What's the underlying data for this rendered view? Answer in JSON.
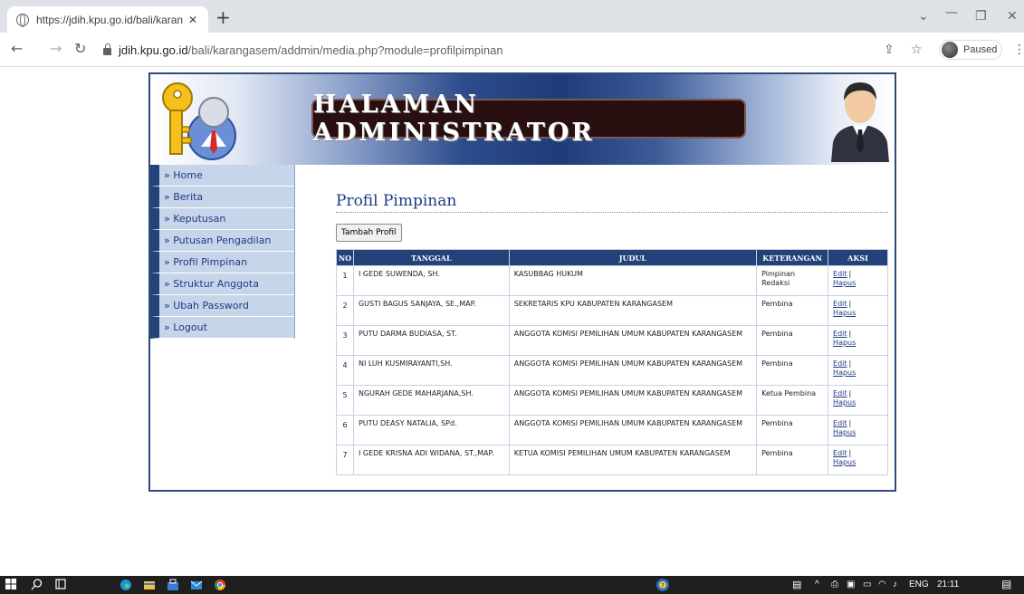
{
  "browser": {
    "tab_title": "https://jdih.kpu.go.id/bali/karang",
    "tab_close": "✕",
    "new_tab": "+",
    "url_host": "jdih.kpu.go.id",
    "url_path": "/bali/karangasem/addmin/media.php?module=profilpimpinan",
    "paused_label": "Paused"
  },
  "header": {
    "banner_text": "HALAMAN ADMINISTRATOR"
  },
  "sidebar": {
    "items": [
      {
        "label": "» Home"
      },
      {
        "label": "» Berita"
      },
      {
        "label": "» Keputusan"
      },
      {
        "label": "» Putusan Pengadilan"
      },
      {
        "label": "» Profil Pimpinan"
      },
      {
        "label": "» Struktur Anggota"
      },
      {
        "label": "» Ubah Password"
      },
      {
        "label": "» Logout"
      }
    ]
  },
  "main": {
    "heading": "Profil Pimpinan",
    "add_button": "Tambah Profil",
    "table": {
      "headers": [
        "NO",
        "TANGGAL",
        "JUDUL",
        "KETERANGAN",
        "AKSI"
      ],
      "edit_label": "Edit",
      "separator": "|",
      "delete_label": "Hapus",
      "rows": [
        {
          "no": "1",
          "tanggal": "I GEDE SUWENDA, SH.",
          "judul": "KASUBBAG HUKUM",
          "keterangan": "Pimpinan Redaksi"
        },
        {
          "no": "2",
          "tanggal": "GUSTI BAGUS SANJAYA, SE.,MAP.",
          "judul": "SEKRETARIS KPU KABUPATEN KARANGASEM",
          "keterangan": "Pembina"
        },
        {
          "no": "3",
          "tanggal": "PUTU DARMA BUDIASA, ST.",
          "judul": "ANGGOTA KOMISI PEMILIHAN UMUM KABUPATEN KARANGASEM",
          "keterangan": "Pembina"
        },
        {
          "no": "4",
          "tanggal": "NI LUH KUSMIRAYANTI,SH.",
          "judul": "ANGGOTA KOMISI PEMILIHAN UMUM KABUPATEN KARANGASEM",
          "keterangan": "Pembina"
        },
        {
          "no": "5",
          "tanggal": "NGURAH GEDE MAHARJANA,SH.",
          "judul": "ANGGOTA KOMISI PEMILIHAN UMUM KABUPATEN KARANGASEM",
          "keterangan": "Ketua Pembina"
        },
        {
          "no": "6",
          "tanggal": "PUTU DEASY NATALIA, SPd.",
          "judul": "ANGGOTA KOMISI PEMILIHAN UMUM KABUPATEN KARANGASEM",
          "keterangan": "Pembina"
        },
        {
          "no": "7",
          "tanggal": "I GEDE KRISNA ADI WIDANA, ST.,MAP.",
          "judul": "KETUA KOMISI PEMILIHAN UMUM KABUPATEN KARANGASEM",
          "keterangan": "Pembina"
        }
      ]
    }
  },
  "taskbar": {
    "language": "ENG",
    "time": "21:11"
  },
  "icons": {
    "tab_favicon": "globe-icon",
    "back": "arrow-left-icon",
    "forward": "arrow-right-icon",
    "reload": "reload-icon",
    "secure": "lock-icon",
    "share": "share-icon",
    "bookmark": "star-icon",
    "menu": "kebab-menu-icon",
    "logo": "key-user-icon",
    "admin": "businessman-icon"
  },
  "colors": {
    "nav_blue": "#23427a",
    "menu_bg": "#c6d5ea",
    "link": "#1f3a84",
    "banner_bg": "#2a0f10"
  }
}
